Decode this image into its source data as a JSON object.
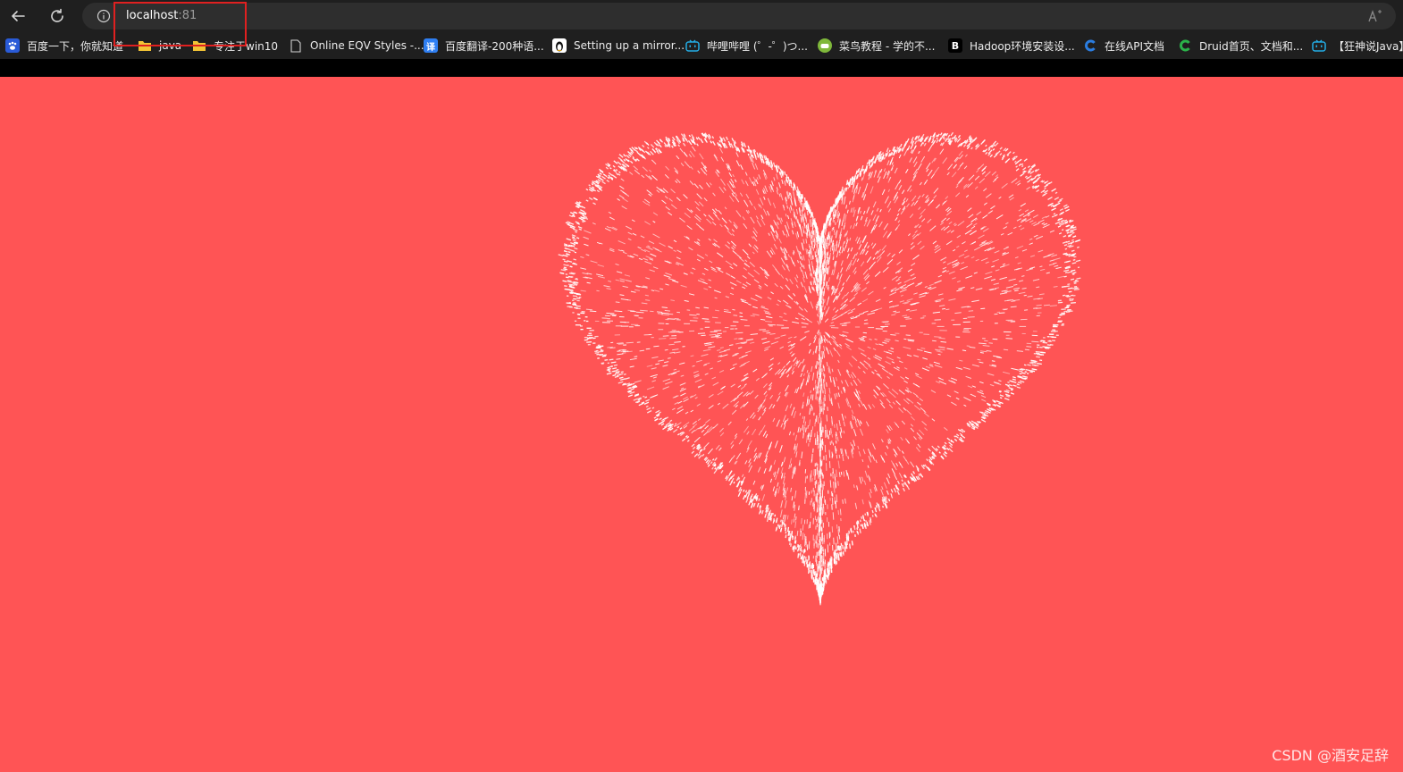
{
  "browser": {
    "address": {
      "host": "localhost",
      "port": ":81"
    }
  },
  "bookmarks": [
    {
      "label": "百度一下，你就知道",
      "icon": "baidu-icon",
      "color": "#2a5bd7"
    },
    {
      "label": "java",
      "icon": "folder-icon",
      "color": "#f2c335"
    },
    {
      "label": "专注于win10",
      "icon": "folder-icon",
      "color": "#f2c335"
    },
    {
      "label": "Online EQV Styles -...",
      "icon": "page-icon",
      "color": "#d0d0d0"
    },
    {
      "label": "百度翻译-200种语...",
      "icon": "translate-icon",
      "color": "#2f7ff2"
    },
    {
      "label": "Setting up a mirror...",
      "icon": "linux-penguin-icon",
      "color": "#ffffff"
    },
    {
      "label": "哔哩哔哩 (゜-゜)つ...",
      "icon": "bilibili-icon",
      "color": "#23ade5"
    },
    {
      "label": "菜鸟教程 - 学的不...",
      "icon": "runoob-icon",
      "color": "#7fb83b"
    },
    {
      "label": "Hadoop环境安装设...",
      "icon": "b-letter-icon",
      "color": "#000000"
    },
    {
      "label": "在线API文档",
      "icon": "c-letter-icon",
      "color": "#2b7de0"
    },
    {
      "label": "Druid首页、文档和...",
      "icon": "c-letter-icon",
      "color": "#2bb34a"
    },
    {
      "label": "【狂神说Java】",
      "icon": "bilibili-icon",
      "color": "#23ade5"
    }
  ],
  "page": {
    "background": "#ff5455",
    "particle_color": "#ffffff",
    "watermark": "CSDN @酒安足辞"
  }
}
